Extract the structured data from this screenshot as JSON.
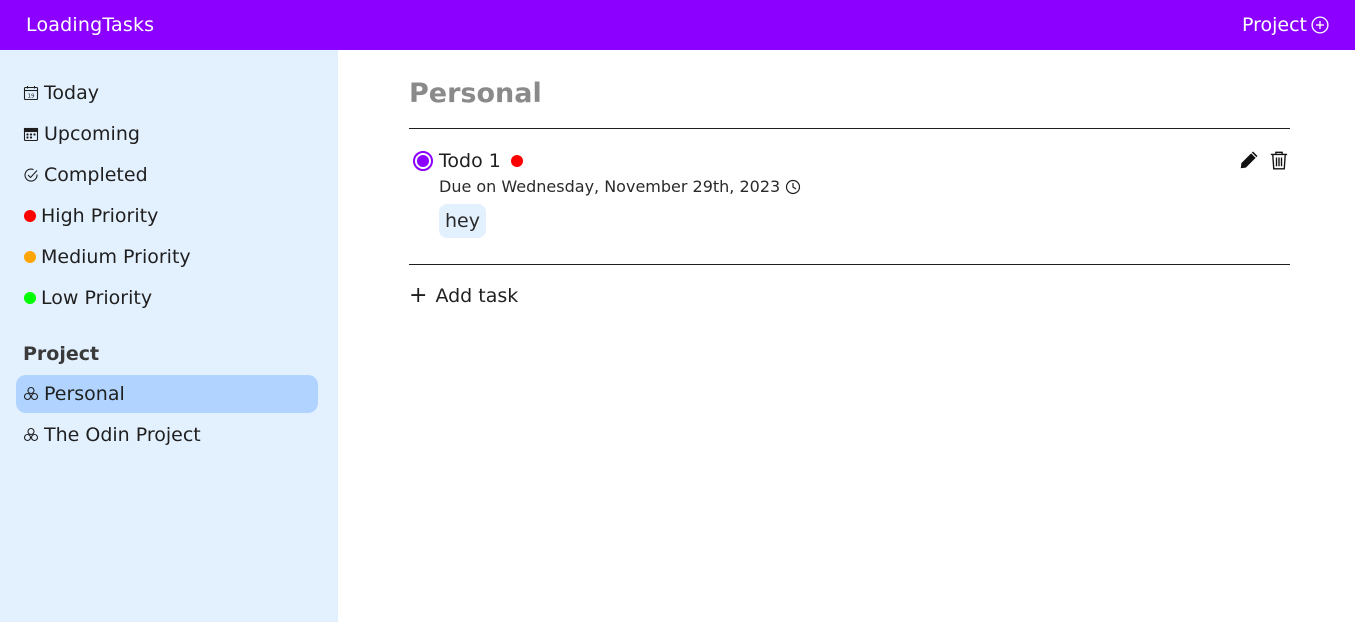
{
  "header": {
    "brand": "LoadingTasks",
    "project_button": "Project"
  },
  "sidebar": {
    "items": [
      {
        "label": "Today",
        "icon": "calendar-day-icon"
      },
      {
        "label": "Upcoming",
        "icon": "calendar-week-icon"
      },
      {
        "label": "Completed",
        "icon": "check-circle-icon"
      },
      {
        "label": "High Priority",
        "color": "#ff0000"
      },
      {
        "label": "Medium Priority",
        "color": "#ffa500"
      },
      {
        "label": "Low Priority",
        "color": "#00ff00"
      }
    ],
    "project_heading": "Project",
    "projects": [
      {
        "label": "Personal",
        "icon": "project-cluster-icon",
        "active": true
      },
      {
        "label": "The Odin Project",
        "icon": "project-cluster-icon",
        "active": false
      }
    ]
  },
  "main": {
    "title": "Personal",
    "tasks": [
      {
        "title": "Todo 1",
        "priority_color": "#ff0000",
        "due": "Due on Wednesday, November 29th, 2023",
        "note": "hey"
      }
    ],
    "add_task": "Add task"
  },
  "colors": {
    "accent": "#8c00ff",
    "sidebar_bg": "#e3f0fe",
    "active_item": "#b0d4ff"
  }
}
